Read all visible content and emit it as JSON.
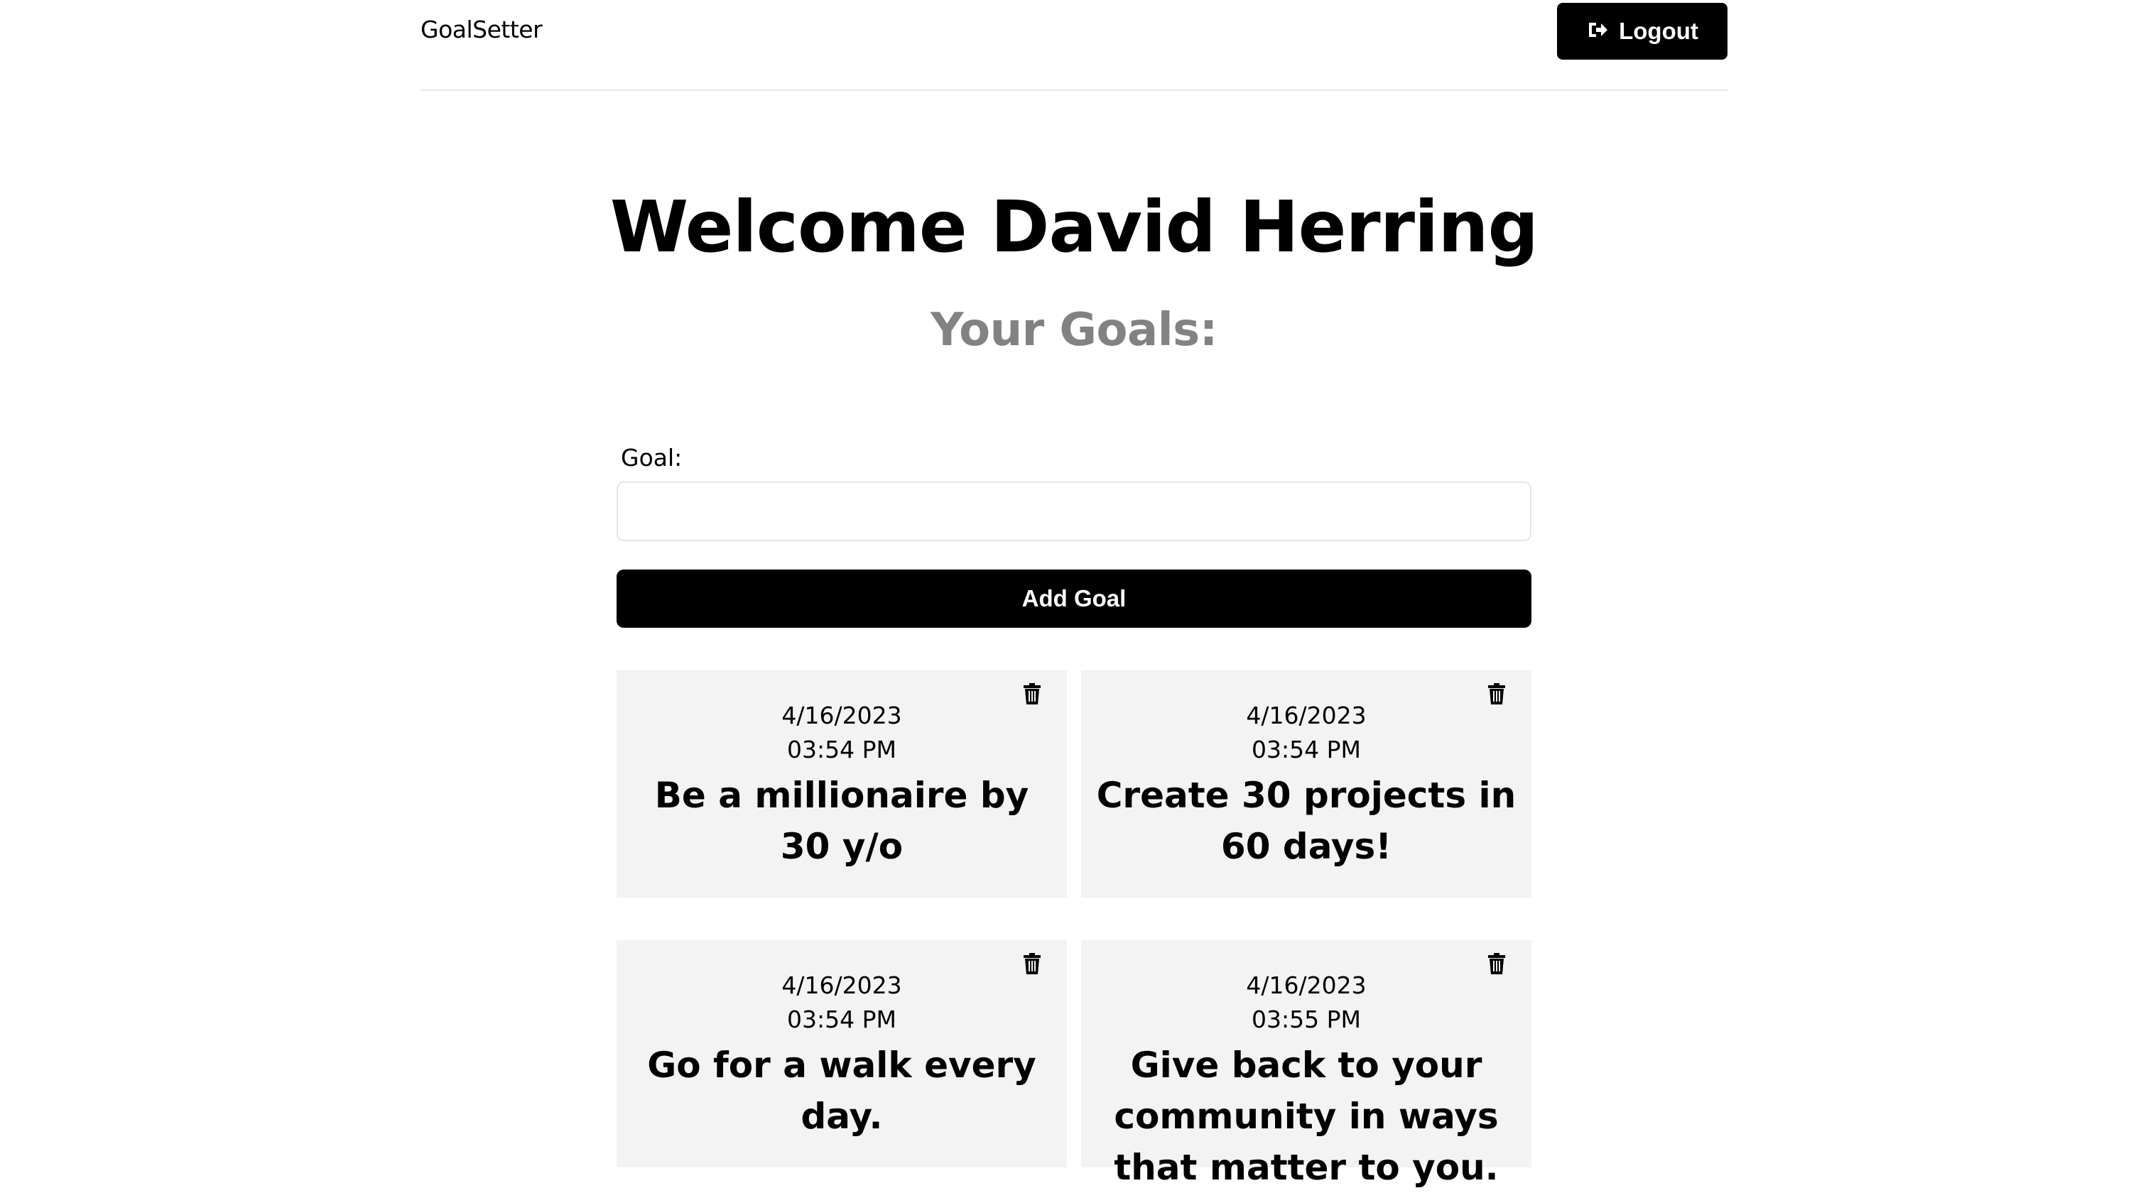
{
  "header": {
    "logo": "GoalSetter",
    "logout_label": "Logout",
    "logout_icon": "sign-out-icon"
  },
  "main": {
    "welcome": "Welcome David Herring",
    "subtitle": "Your Goals:"
  },
  "form": {
    "goal_label": "Goal:",
    "goal_value": "",
    "add_button_label": "Add Goal"
  },
  "goals": [
    {
      "date": "4/16/2023",
      "time": "03:54 PM",
      "text": "Be a millionaire by 30 y/o",
      "delete_icon": "trash-icon"
    },
    {
      "date": "4/16/2023",
      "time": "03:54 PM",
      "text": "Create 30 projects in 60 days!",
      "delete_icon": "trash-icon"
    },
    {
      "date": "4/16/2023",
      "time": "03:54 PM",
      "text": "Go for a walk every day.",
      "delete_icon": "trash-icon"
    },
    {
      "date": "4/16/2023",
      "time": "03:55 PM",
      "text": "Give back to your community in ways that matter to you.",
      "delete_icon": "trash-icon"
    }
  ],
  "colors": {
    "primary": "#000000",
    "card_background": "#f3f3f3",
    "subtitle": "#828282",
    "divider": "#e6e6e6"
  }
}
